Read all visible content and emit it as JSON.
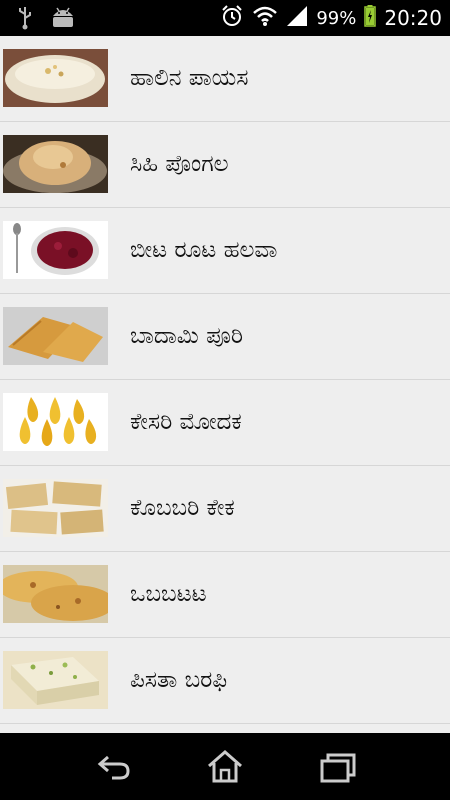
{
  "status_bar": {
    "icons_left": [
      "usb-icon",
      "android-icon"
    ],
    "icons_right": [
      "alarm-icon",
      "wifi-icon",
      "signal-icon",
      "battery-charging-icon"
    ],
    "battery_percent": "99%",
    "time": "20:20"
  },
  "recipes": [
    {
      "name": "ಹಾಲಿನ ಪಾಯಸ",
      "image": "milk-payasam-bowl"
    },
    {
      "name": "ಸಿಹಿ ಪೊಂಗಲ",
      "image": "sweet-pongal-plate"
    },
    {
      "name": "ಬೀಟ ರೂಟ ಹಲವಾ",
      "image": "beetroot-halwa-bowl"
    },
    {
      "name": "ಬಾದಾಮಿ ಪೂರಿ",
      "image": "badami-puri"
    },
    {
      "name": "ಕೇಸರಿ ಮೋದಕ",
      "image": "kesari-modak"
    },
    {
      "name": "ಕೊಬಬರಿ ಕೇಕ",
      "image": "coconut-cake-squares"
    },
    {
      "name": "ಒಬಬಟಟ",
      "image": "obbattu-flatbread"
    },
    {
      "name": "ಪಿಸತಾ ಬರಫಿ",
      "image": "pista-barfi"
    }
  ],
  "nav_bar": {
    "buttons": [
      "back-icon",
      "home-icon",
      "recent-apps-icon"
    ]
  }
}
